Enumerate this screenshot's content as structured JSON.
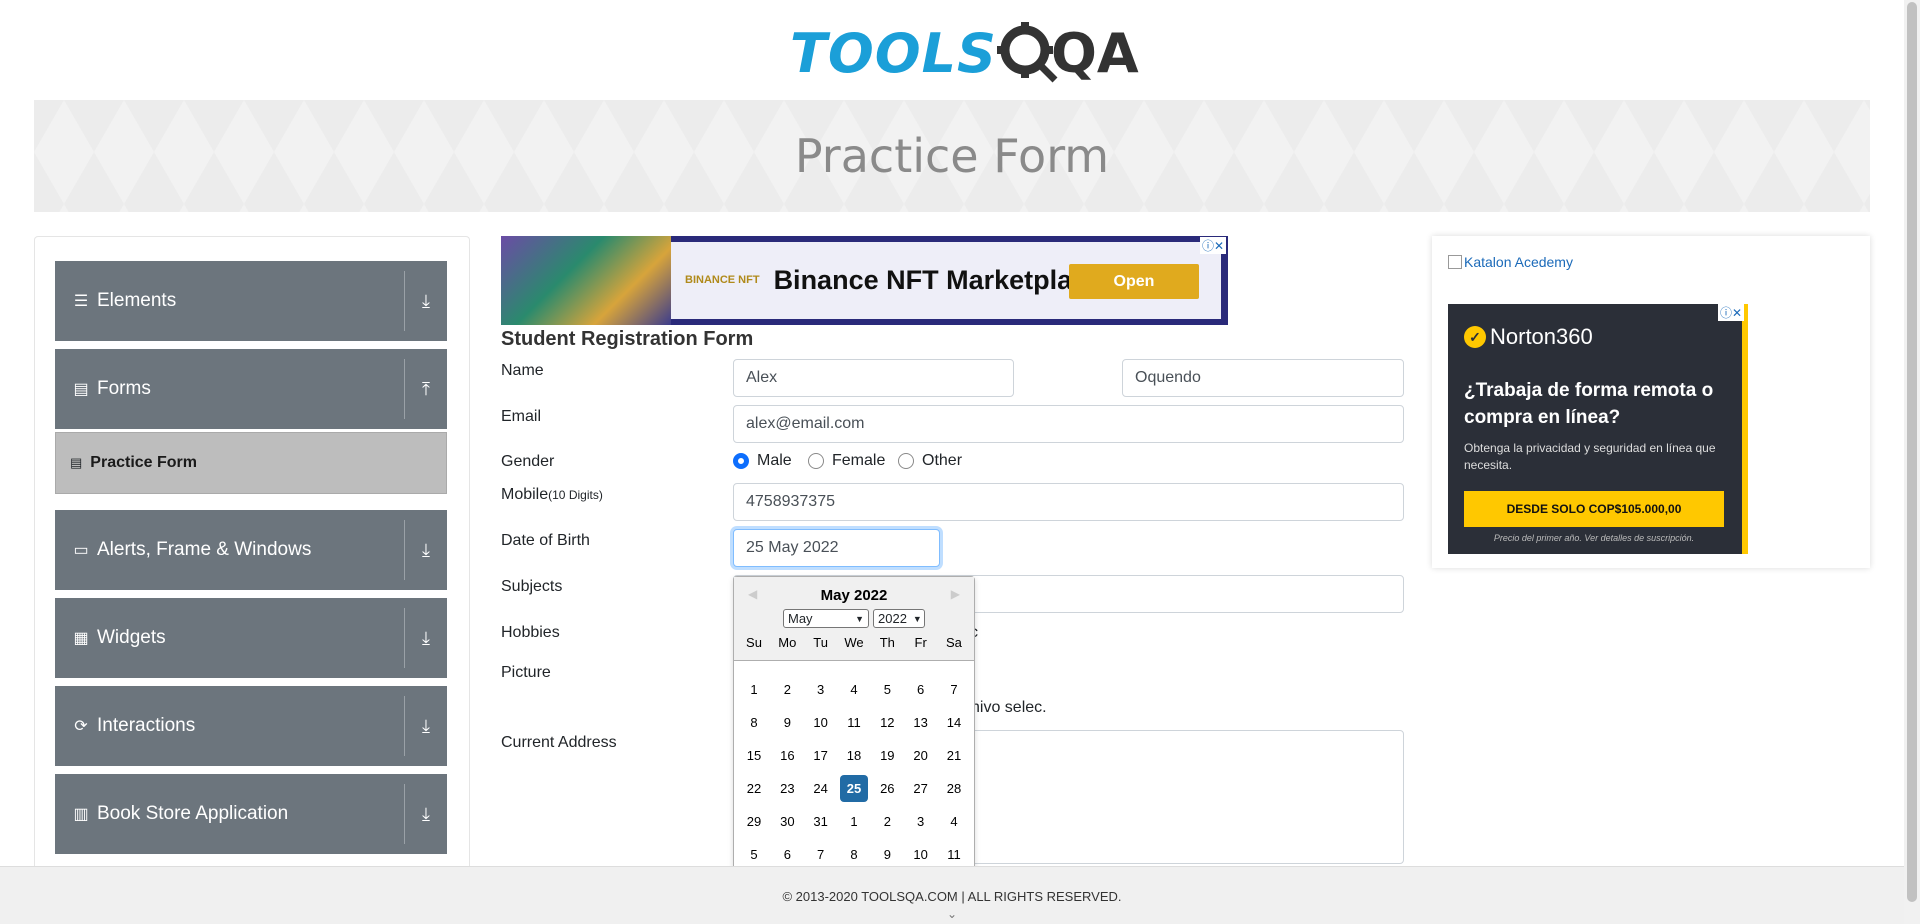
{
  "header": {
    "logo_tools": "TOOLS",
    "logo_qa": "QA",
    "page_title": "Practice Form"
  },
  "sidebar": {
    "groups": [
      {
        "label": "Elements",
        "icon": "hamburger-icon",
        "arrow": "download-icon"
      },
      {
        "label": "Forms",
        "icon": "document-icon",
        "arrow": "upload-icon"
      },
      {
        "label": "Alerts, Frame & Windows",
        "icon": "window-icon",
        "arrow": "download-icon"
      },
      {
        "label": "Widgets",
        "icon": "grid-icon",
        "arrow": "download-icon"
      },
      {
        "label": "Interactions",
        "icon": "cycle-icon",
        "arrow": "download-icon"
      },
      {
        "label": "Book Store Application",
        "icon": "books-icon",
        "arrow": "download-icon"
      }
    ],
    "active_item": "Practice Form"
  },
  "ad_banner": {
    "brand": "BINANCE NFT",
    "title": "Binance NFT Marketplace",
    "button": "Open"
  },
  "form": {
    "title": "Student Registration Form",
    "labels": {
      "name": "Name",
      "email": "Email",
      "gender": "Gender",
      "mobile": "Mobile",
      "mobile_hint": "(10 Digits)",
      "dob": "Date of Birth",
      "subjects": "Subjects",
      "hobbies": "Hobbies",
      "picture": "Picture",
      "current_address": "Current Address"
    },
    "first_name": "Alex",
    "last_name": "Oquendo",
    "email": "alex@email.com",
    "gender_options": [
      "Male",
      "Female",
      "Other"
    ],
    "gender_selected": "Male",
    "mobile": "4758937375",
    "dob": "25 May 2022",
    "hobbies_partial": "c",
    "picture_partial": "hivo selec."
  },
  "datepicker": {
    "title": "May 2022",
    "month_select": "May",
    "year_select": "2022",
    "weekdays": [
      "Su",
      "Mo",
      "Tu",
      "We",
      "Th",
      "Fr",
      "Sa"
    ],
    "weeks": [
      [
        "1",
        "2",
        "3",
        "4",
        "5",
        "6",
        "7"
      ],
      [
        "8",
        "9",
        "10",
        "11",
        "12",
        "13",
        "14"
      ],
      [
        "15",
        "16",
        "17",
        "18",
        "19",
        "20",
        "21"
      ],
      [
        "22",
        "23",
        "24",
        "25",
        "26",
        "27",
        "28"
      ],
      [
        "29",
        "30",
        "31",
        "1",
        "2",
        "3",
        "4"
      ],
      [
        "5",
        "6",
        "7",
        "8",
        "9",
        "10",
        "11"
      ]
    ],
    "selected_day": "25"
  },
  "right_ad": {
    "alt_text": "Katalon Acedemy",
    "norton_logo": "Norton360",
    "headline": "¿Trabaja de forma remota o compra en línea?",
    "sub": "Obtenga la privacidad y seguridad en línea que necesita.",
    "button": "DESDE SOLO COP$105.000,00",
    "fine_print": "Precio del primer año. Ver detalles de suscripción."
  },
  "footer": {
    "copyright": "© 2013-2020 TOOLSQA.COM | ALL RIGHTS RESERVED."
  },
  "colors": {
    "sidebar_group": "#6c757d",
    "accent_blue": "#1b9fd8",
    "datepicker_selected": "#216ba5",
    "radio_checked": "#0d6efd"
  }
}
